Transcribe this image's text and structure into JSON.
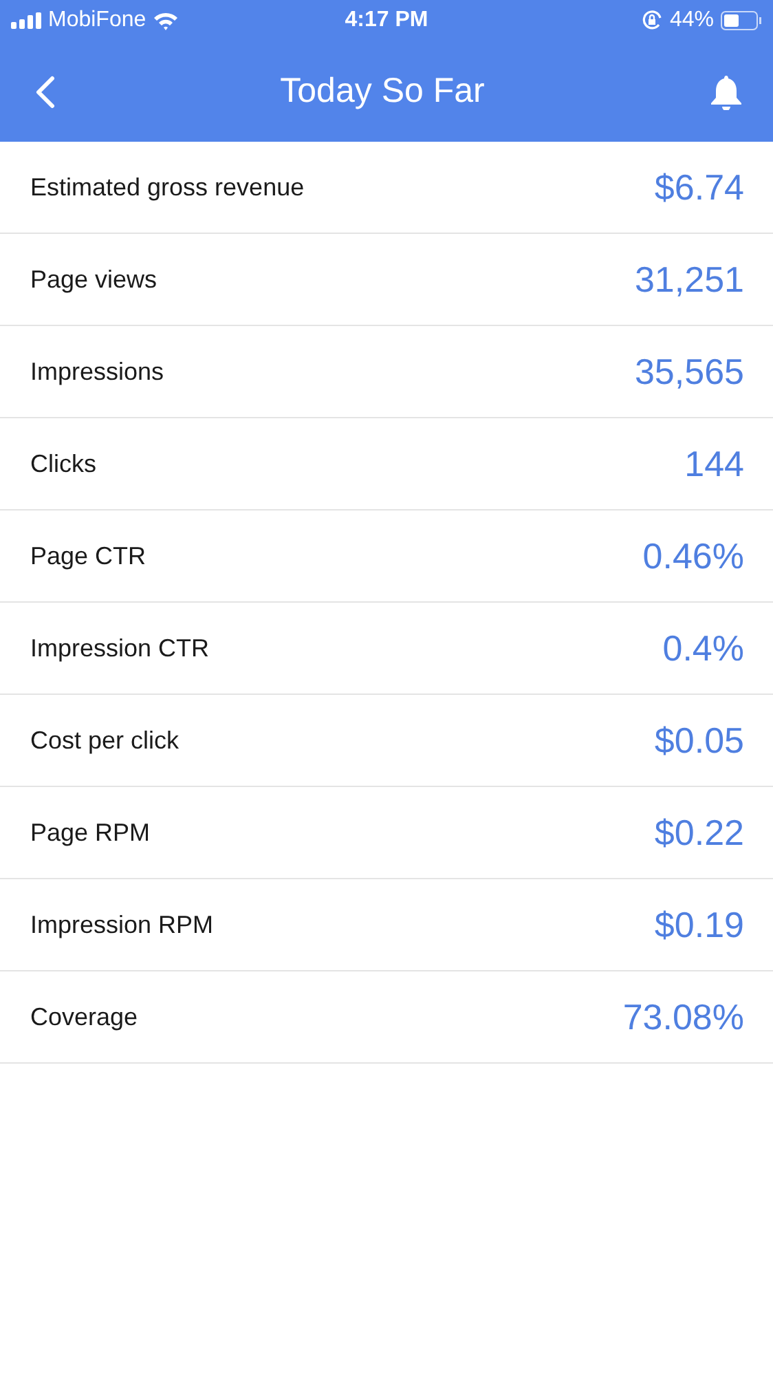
{
  "status_bar": {
    "carrier": "MobiFone",
    "time": "4:17 PM",
    "battery": "44%"
  },
  "header": {
    "title": "Today So Far"
  },
  "metrics": [
    {
      "label": "Estimated gross revenue",
      "value": "$6.74"
    },
    {
      "label": "Page views",
      "value": "31,251"
    },
    {
      "label": "Impressions",
      "value": "35,565"
    },
    {
      "label": "Clicks",
      "value": "144"
    },
    {
      "label": "Page CTR",
      "value": "0.46%"
    },
    {
      "label": "Impression CTR",
      "value": "0.4%"
    },
    {
      "label": "Cost per click",
      "value": "$0.05"
    },
    {
      "label": "Page RPM",
      "value": "$0.22"
    },
    {
      "label": "Impression RPM",
      "value": "$0.19"
    },
    {
      "label": "Coverage",
      "value": "73.08%"
    }
  ]
}
